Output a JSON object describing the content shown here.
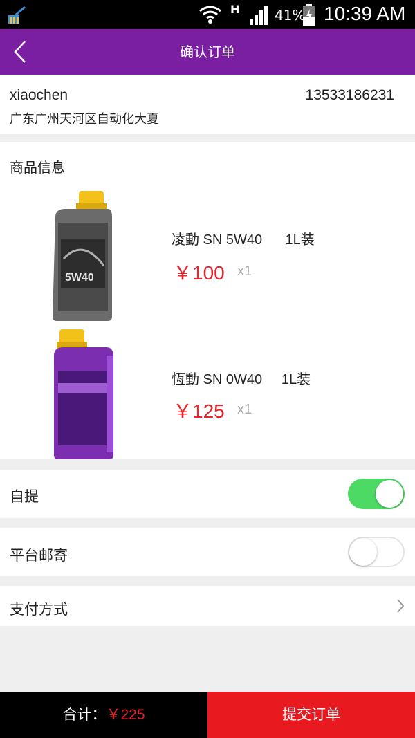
{
  "status_bar": {
    "network_type": "H",
    "battery": "41%",
    "time": "10:39 AM"
  },
  "nav": {
    "title": "确认订单",
    "back_icon": "chevron-left-icon"
  },
  "address": {
    "name": "xiaochen",
    "phone": "13533186231",
    "detail": "广东广州天河区自动化大夏"
  },
  "goods": {
    "header": "商品信息",
    "items": [
      {
        "name": "凌動 SN 5W40      1L装",
        "price": "￥100",
        "qty": "x1",
        "bottle_color": "#6b6b6b",
        "cap_color": "#f2c21b"
      },
      {
        "name": "恆動 SN 0W40     1L装",
        "price": "￥125",
        "qty": "x1",
        "bottle_color": "#7b2fb0",
        "cap_color": "#f2c21b"
      }
    ]
  },
  "delivery": {
    "self_pickup": {
      "label": "自提",
      "enabled": true
    },
    "platform_mail": {
      "label": "平台邮寄",
      "enabled": false
    }
  },
  "payment": {
    "label": "支付方式"
  },
  "footer": {
    "total_label": "合计：",
    "total_amount": "￥225",
    "submit_label": "提交订单"
  },
  "colors": {
    "brand": "#7b1fa2",
    "price": "#e8232b",
    "toggle_on": "#4cd964",
    "submit_bg": "#e8191f"
  }
}
